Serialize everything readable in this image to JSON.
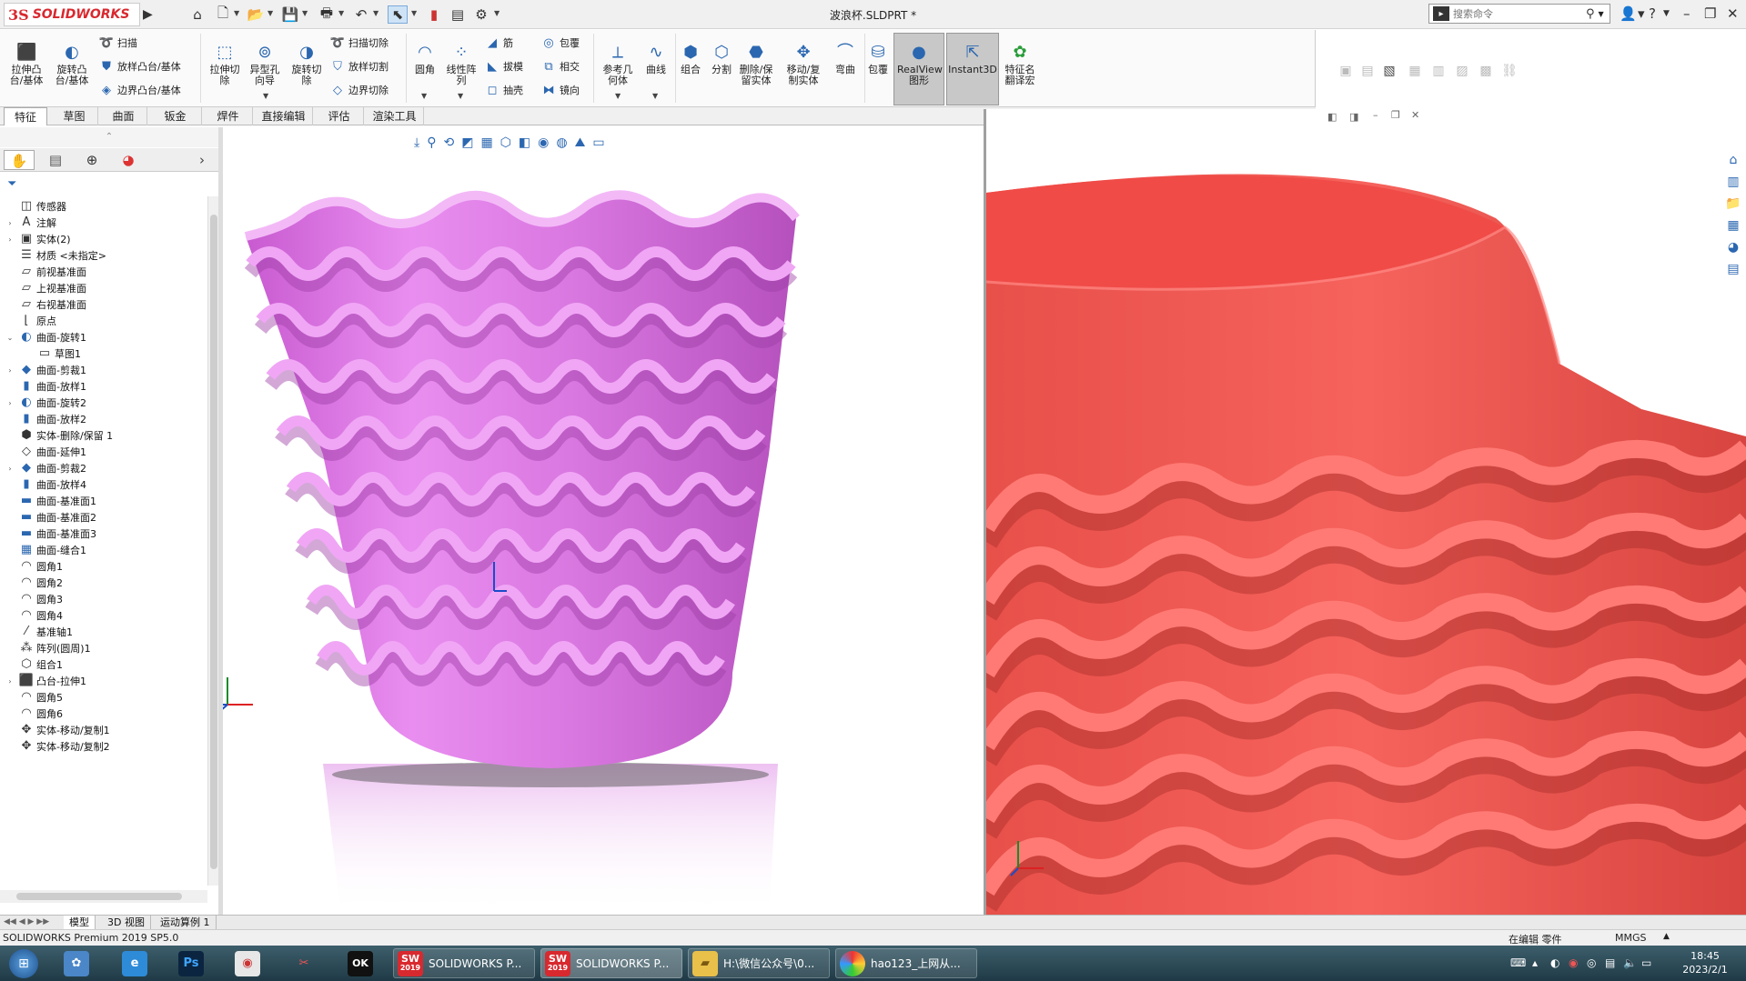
{
  "window": {
    "logo_ds": "3S",
    "logo_text": "SOLIDWORKS",
    "doc_title": "波浪杯.SLDPRT *",
    "search_placeholder": "搜索命令",
    "search_icon": "magnifier-icon"
  },
  "ribbon": {
    "extrude_boss": "拉伸凸\n台/基体",
    "revolve_boss": "旋转凸\n台/基体",
    "sweep": "扫描",
    "loft_boss": "放样凸台/基体",
    "boundary_boss": "边界凸台/基体",
    "extrude_cut": "拉伸切\n除",
    "hole_wizard": "异型孔\n向导",
    "revolve_cut": "旋转切\n除",
    "sweep_cut": "扫描切除",
    "loft_cut": "放样切割",
    "boundary_cut": "边界切除",
    "fillet": "圆角",
    "linear_pattern": "线性阵\n列",
    "rib": "筋",
    "draft": "拔模",
    "shell": "抽壳",
    "wrap": "包覆",
    "intersect": "相交",
    "mirror": "镜向",
    "ref_geometry": "参考几\n何体",
    "curves": "曲线",
    "combine": "组合",
    "split": "分割",
    "delete_keep": "删除/保\n留实体",
    "move_copy": "移动/复\n制实体",
    "flex": "弯曲",
    "wrap2": "包覆",
    "realview": "RealView\n图形",
    "instant3d": "Instant3D",
    "feature_translator": "特征名\n翻译宏"
  },
  "tabs": [
    "特征",
    "草图",
    "曲面",
    "钣金",
    "焊件",
    "直接编辑",
    "评估",
    "渲染工具"
  ],
  "tree": [
    {
      "label": "传感器",
      "icon": "sensor-icon",
      "expand": ""
    },
    {
      "label": "注解",
      "icon": "annotation-icon",
      "expand": "›"
    },
    {
      "label": "实体(2)",
      "icon": "solid-bodies-icon",
      "expand": "›"
    },
    {
      "label": "材质 <未指定>",
      "icon": "material-icon",
      "expand": ""
    },
    {
      "label": "前视基准面",
      "icon": "plane-icon",
      "expand": ""
    },
    {
      "label": "上视基准面",
      "icon": "plane-icon",
      "expand": ""
    },
    {
      "label": "右视基准面",
      "icon": "plane-icon",
      "expand": ""
    },
    {
      "label": "原点",
      "icon": "origin-icon",
      "expand": ""
    },
    {
      "label": "曲面-旋转1",
      "icon": "surface-revolve-icon",
      "expand": "⌄"
    },
    {
      "label": "草图1",
      "icon": "sketch-icon",
      "expand": "",
      "indent": true
    },
    {
      "label": "曲面-剪裁1",
      "icon": "surface-trim-icon",
      "expand": "›"
    },
    {
      "label": "曲面-放样1",
      "icon": "surface-loft-icon",
      "expand": ""
    },
    {
      "label": "曲面-旋转2",
      "icon": "surface-revolve-icon",
      "expand": "›"
    },
    {
      "label": "曲面-放样2",
      "icon": "surface-loft-icon",
      "expand": ""
    },
    {
      "label": "实体-删除/保留 1",
      "icon": "body-delete-icon",
      "expand": ""
    },
    {
      "label": "曲面-延伸1",
      "icon": "surface-extend-icon",
      "expand": ""
    },
    {
      "label": "曲面-剪裁2",
      "icon": "surface-trim-icon",
      "expand": "›"
    },
    {
      "label": "曲面-放样4",
      "icon": "surface-loft-icon",
      "expand": ""
    },
    {
      "label": "曲面-基准面1",
      "icon": "planar-surface-icon",
      "expand": ""
    },
    {
      "label": "曲面-基准面2",
      "icon": "planar-surface-icon",
      "expand": ""
    },
    {
      "label": "曲面-基准面3",
      "icon": "planar-surface-icon",
      "expand": ""
    },
    {
      "label": "曲面-缝合1",
      "icon": "surface-knit-icon",
      "expand": ""
    },
    {
      "label": "圆角1",
      "icon": "fillet-icon",
      "expand": ""
    },
    {
      "label": "圆角2",
      "icon": "fillet-icon",
      "expand": ""
    },
    {
      "label": "圆角3",
      "icon": "fillet-icon",
      "expand": ""
    },
    {
      "label": "圆角4",
      "icon": "fillet-icon",
      "expand": ""
    },
    {
      "label": "基准轴1",
      "icon": "axis-icon",
      "expand": ""
    },
    {
      "label": "阵列(圆周)1",
      "icon": "circular-pattern-icon",
      "expand": ""
    },
    {
      "label": "组合1",
      "icon": "combine-icon",
      "expand": ""
    },
    {
      "label": "凸台-拉伸1",
      "icon": "boss-extrude-icon",
      "expand": "›"
    },
    {
      "label": "圆角5",
      "icon": "fillet-icon",
      "expand": ""
    },
    {
      "label": "圆角6",
      "icon": "fillet-icon",
      "expand": ""
    },
    {
      "label": "实体-移动/复制1",
      "icon": "move-copy-icon",
      "expand": ""
    },
    {
      "label": "实体-移动/复制2",
      "icon": "move-copy-icon",
      "expand": ""
    }
  ],
  "status_tabs": [
    "模型",
    "3D 视图",
    "运动算例 1"
  ],
  "status": {
    "product": "SOLIDWORKS Premium 2019 SP5.0",
    "editing": "在编辑 零件",
    "units": "MMGS"
  },
  "taskbar": {
    "apps": [
      {
        "label": "SOLIDWORKS P...",
        "badge": "SW"
      },
      {
        "label": "SOLIDWORKS P...",
        "badge": "SW"
      },
      {
        "label": "H:\\微信公众号\\0...",
        "badge": ""
      },
      {
        "label": "hao123_上网从...",
        "badge": ""
      }
    ],
    "sw_year": "2019",
    "time": "18:45",
    "date": "2023/2/1"
  },
  "colors": {
    "left_model": "#e07ae6",
    "right_model": "#f2534f",
    "accent": "#2b67b0"
  }
}
